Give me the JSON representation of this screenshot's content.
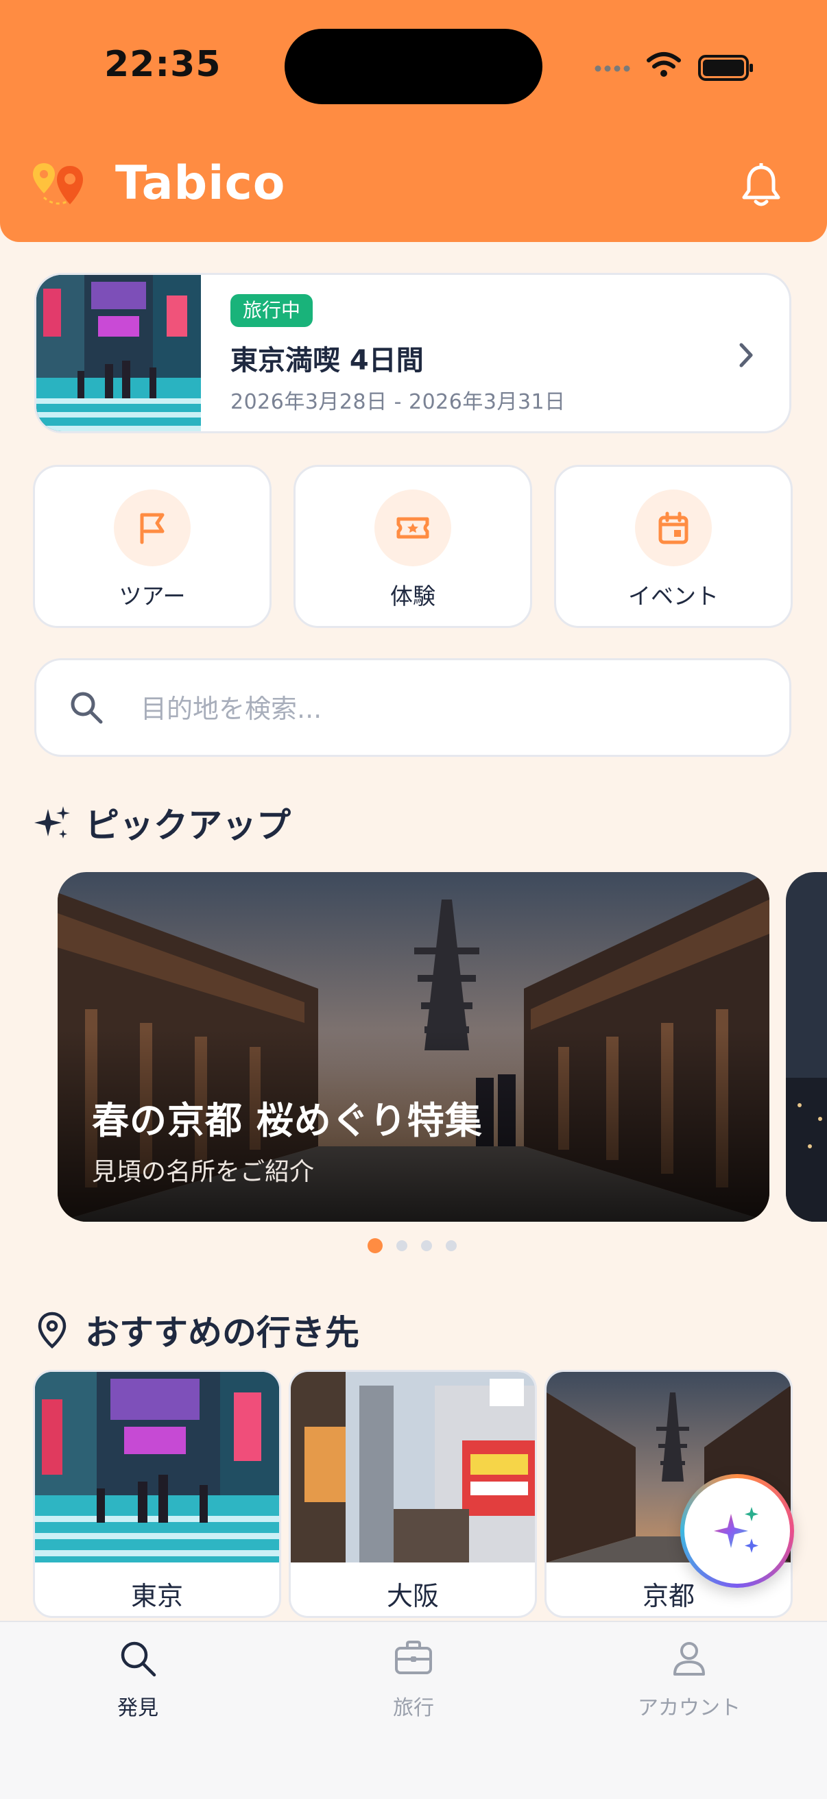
{
  "status_bar": {
    "time": "22:35"
  },
  "header": {
    "app_name": "Tabico"
  },
  "trip": {
    "badge": "旅行中",
    "title": "東京満喫 4日間",
    "dates": "2026年3月28日 - 2026年3月31日"
  },
  "categories": [
    {
      "label": "ツアー",
      "icon": "flag-icon"
    },
    {
      "label": "体験",
      "icon": "ticket-icon"
    },
    {
      "label": "イベント",
      "icon": "calendar-icon"
    }
  ],
  "search": {
    "placeholder": "目的地を検索..."
  },
  "pickup": {
    "title": "ピックアップ",
    "banner_title": "春の京都 桜めぐり特集",
    "banner_subtitle": "見頃の名所をご紹介",
    "page_count": 4,
    "active_page": 1
  },
  "destinations": {
    "title": "おすすめの行き先",
    "items": [
      {
        "label": "東京"
      },
      {
        "label": "大阪"
      },
      {
        "label": "京都"
      }
    ]
  },
  "tabbar": {
    "items": [
      {
        "label": "発見",
        "icon": "search-icon",
        "active": true
      },
      {
        "label": "旅行",
        "icon": "briefcase-icon",
        "active": false
      },
      {
        "label": "アカウント",
        "icon": "person-icon",
        "active": false
      }
    ]
  },
  "colors": {
    "brand": "#FF8C42",
    "background": "#FDF3EA",
    "badge": "#19B37A",
    "text": "#1F2940",
    "muted": "#7A8294"
  }
}
